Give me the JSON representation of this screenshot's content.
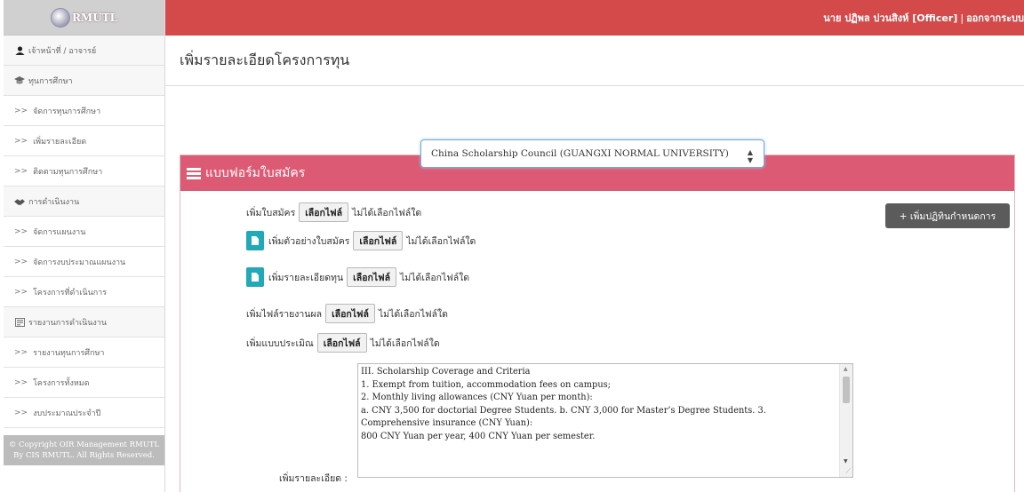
{
  "app": {
    "logo_text": "RMUTL",
    "user_line": {
      "user": "นาย ปฏิพล ปวนสิงห์ [Officer]",
      "separator": "|",
      "logout": "ออกจากระบบ"
    },
    "footer": "© Copyright OIR Management RMUTL By CIS RMUTL. All Rights Reserved."
  },
  "sidebar": {
    "items": [
      {
        "label": "เจ้าหน้าที่ / อาจารย์",
        "icon": "user-icon",
        "type": "header"
      },
      {
        "label": "ทุนการศึกษา",
        "icon": "graduation-icon",
        "type": "header"
      },
      {
        "label": "จัดการทุนการศึกษา",
        "type": "link"
      },
      {
        "label": "เพิ่มรายละเอียด",
        "type": "link"
      },
      {
        "label": "ติดตามทุนการศึกษา",
        "type": "link"
      },
      {
        "label": "การดำเนินงาน",
        "icon": "handshake-icon",
        "type": "header"
      },
      {
        "label": "จัดการแผนงาน",
        "type": "link"
      },
      {
        "label": "จัดการงบประมาณแผนงาน",
        "type": "link"
      },
      {
        "label": "โครงการที่ดำเนินการ",
        "type": "link"
      },
      {
        "label": "รายงานการดำเนินงาน",
        "icon": "report-icon",
        "type": "header"
      },
      {
        "label": "รายงานทุนการศึกษา",
        "type": "link"
      },
      {
        "label": "โครงการทั้งหมด",
        "type": "link"
      },
      {
        "label": "งบประมาณประจำปี",
        "type": "link"
      }
    ],
    "arrow": ">>"
  },
  "main": {
    "title": "เพิ่มรายละเอียดโครงการทุน",
    "scholarship_select": {
      "selected": "China Scholarship Council (GUANGXI NORMAL UNIVERSITY)"
    },
    "panel_title": "แบบฟอร์มใบสมัคร",
    "add_calendar_button": "+ เพิ่มปฏิทินกำหนดการ",
    "file_button_label": "เลือกไฟล์",
    "no_file_text": "ไม่ได้เลือกไฟล์ใด",
    "uploads": [
      {
        "label": "เพิ่มใบสมัคร",
        "has_icon": false
      },
      {
        "label": "เพิ่มตัวอย่างใบสมัคร",
        "has_icon": true
      },
      {
        "label": "เพิ่มรายละเอียดทุน",
        "has_icon": true
      },
      {
        "label": "เพิ่มไฟล์รายงานผล",
        "has_icon": false
      },
      {
        "label": "เพิ่มแบบประเมิณ",
        "has_icon": false
      }
    ],
    "detail_label": "เพิ่มรายละเอียด :",
    "detail_text": "III. Scholarship Coverage and Criteria\n1. Exempt from tuition, accommodation fees on campus;\n2. Monthly living allowances (CNY Yuan per month):\na. CNY 3,500 for doctorial Degree Students. b. CNY 3,000 for Master’s Degree Students. 3. Comprehensive insurance (CNY Yuan):\n800 CNY Yuan per year, 400 CNY Yuan per semester."
  }
}
